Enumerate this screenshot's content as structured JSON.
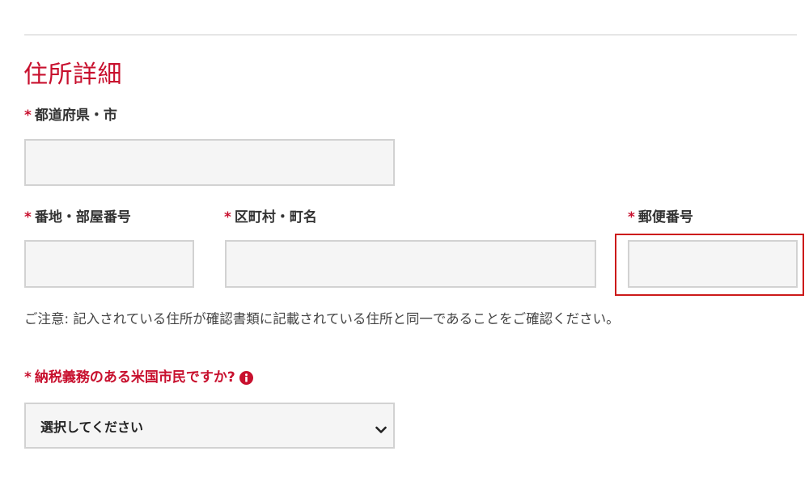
{
  "section": {
    "title": "住所詳細"
  },
  "required_marker": "*",
  "fields": {
    "prefecture_city": {
      "label": "都道府県・市",
      "value": ""
    },
    "street_room": {
      "label": "番地・部屋番号",
      "value": ""
    },
    "ward_town": {
      "label": "区町村・町名",
      "value": ""
    },
    "postal_code": {
      "label": "郵便番号",
      "value": ""
    }
  },
  "notice": "ご注意: 記入されている住所が確認書類に記載されている住所と同一であることをご確認ください。",
  "tax_question": {
    "label": "納税義務のある米国市民ですか?",
    "selected": "選択してください",
    "icon": "info-icon"
  },
  "colors": {
    "accent": "#c8102e",
    "input_bg": "#f5f5f5",
    "input_border": "#d2d2d2",
    "highlight": "#cc1a1a"
  }
}
